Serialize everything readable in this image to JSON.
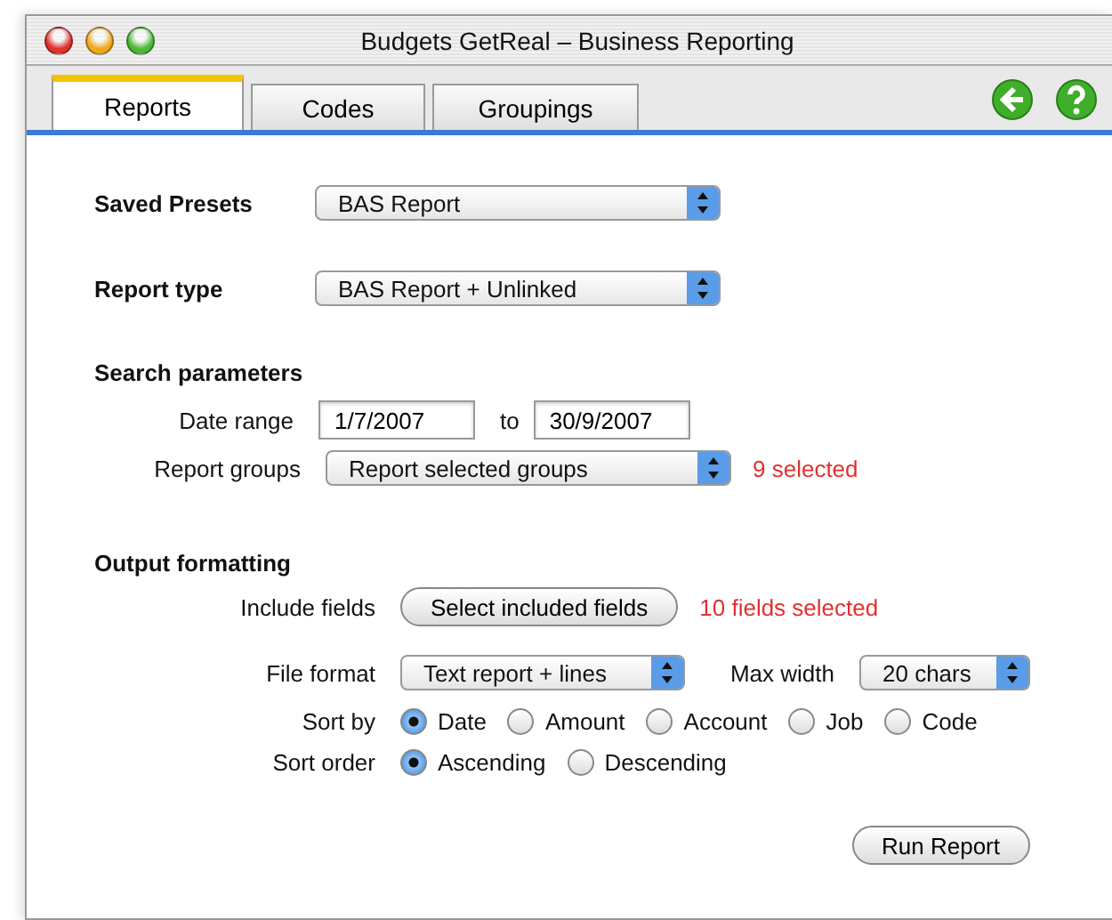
{
  "window": {
    "title": "Budgets GetReal – Business Reporting"
  },
  "tabs": [
    {
      "label": "Reports",
      "selected": true
    },
    {
      "label": "Codes",
      "selected": false
    },
    {
      "label": "Groupings",
      "selected": false
    }
  ],
  "saved_presets": {
    "label": "Saved Presets",
    "value": "BAS Report"
  },
  "report_type": {
    "label": "Report type",
    "value": "BAS Report + Unlinked"
  },
  "search_parameters": {
    "heading": "Search parameters",
    "date_range": {
      "label": "Date range",
      "from": "1/7/2007",
      "separator": "to",
      "to": "30/9/2007"
    },
    "report_groups": {
      "label": "Report groups",
      "value": "Report selected groups",
      "note": "9 selected"
    }
  },
  "output_formatting": {
    "heading": "Output formatting",
    "include_fields": {
      "label": "Include fields",
      "button": "Select included fields",
      "note": "10 fields selected"
    },
    "file_format": {
      "label": "File format",
      "value": "Text report + lines"
    },
    "max_width": {
      "label": "Max width",
      "value": "20 chars"
    },
    "sort_by": {
      "label": "Sort by",
      "options": [
        {
          "label": "Date",
          "selected": true
        },
        {
          "label": "Amount",
          "selected": false
        },
        {
          "label": "Account",
          "selected": false
        },
        {
          "label": "Job",
          "selected": false
        },
        {
          "label": "Code",
          "selected": false
        }
      ]
    },
    "sort_order": {
      "label": "Sort order",
      "options": [
        {
          "label": "Ascending",
          "selected": true
        },
        {
          "label": "Descending",
          "selected": false
        }
      ]
    }
  },
  "run_button": "Run Report"
}
